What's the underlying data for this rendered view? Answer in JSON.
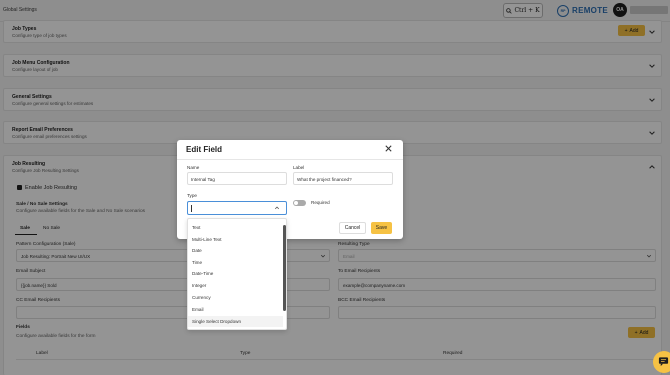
{
  "header": {
    "breadcrumb": "Global Settings",
    "shortcut": "Ctrl + K",
    "search_icon": "search-icon",
    "logo_badge": "RP",
    "logo_text": "REMOTE",
    "avatar_initials": "OA"
  },
  "sections": [
    {
      "title": "Job Types",
      "subtitle": "Configure type of job types",
      "add_label": "Add"
    },
    {
      "title": "Job Menu Configuration",
      "subtitle": "Configure layout of job"
    },
    {
      "title": "General Settings",
      "subtitle": "Configure general settings for estimates"
    },
    {
      "title": "Report Email Preferences",
      "subtitle": "Configure email preferences settings"
    },
    {
      "title": "Job Resulting",
      "subtitle": "Configure Job Resulting Settings"
    }
  ],
  "job_resulting": {
    "enable_label": "Enable Job Resulting",
    "sale_title": "Sale / No Sale Settings",
    "sale_subtitle": "Configure available fields for the Sale and No Sale scenarios",
    "tabs": [
      "Sale",
      "No Sale"
    ],
    "pattern_label": "Pattern Configuration (Sale)",
    "pattern_value": "Job Resulting: Portrait New UI/UX",
    "resulting_type_label": "Resulting Type",
    "resulting_type_value": "Email",
    "email_subject_label": "Email Subject",
    "email_subject_value": "{{job.name}} Sold",
    "to_email_label": "To Email Recipients",
    "to_email_value": "example@companyname.com",
    "cc_email_label": "CC Email Recipients",
    "bcc_email_label": "BCC Email Recipients",
    "fields_title": "Fields",
    "fields_subtitle": "Configure available fields for the form",
    "fields_add_label": "Add",
    "columns": [
      "Label",
      "Type",
      "Required"
    ]
  },
  "modal": {
    "title": "Edit Field",
    "name_label": "Name",
    "name_value": "Internal Tag",
    "label_label": "Label",
    "label_value": "What the project financed?",
    "type_label": "Type",
    "type_value": "",
    "required_label": "Required",
    "required_on": false,
    "cancel_label": "Cancel",
    "save_label": "Save"
  },
  "type_options": [
    "Text",
    "Multi-Line Text",
    "Date",
    "Time",
    "Date-Time",
    "Integer",
    "Currency",
    "Email",
    "Single Select Dropdown"
  ],
  "colors": {
    "accent": "#f6c244",
    "focus": "#4a8fd8",
    "logo": "#2d6fb3"
  }
}
